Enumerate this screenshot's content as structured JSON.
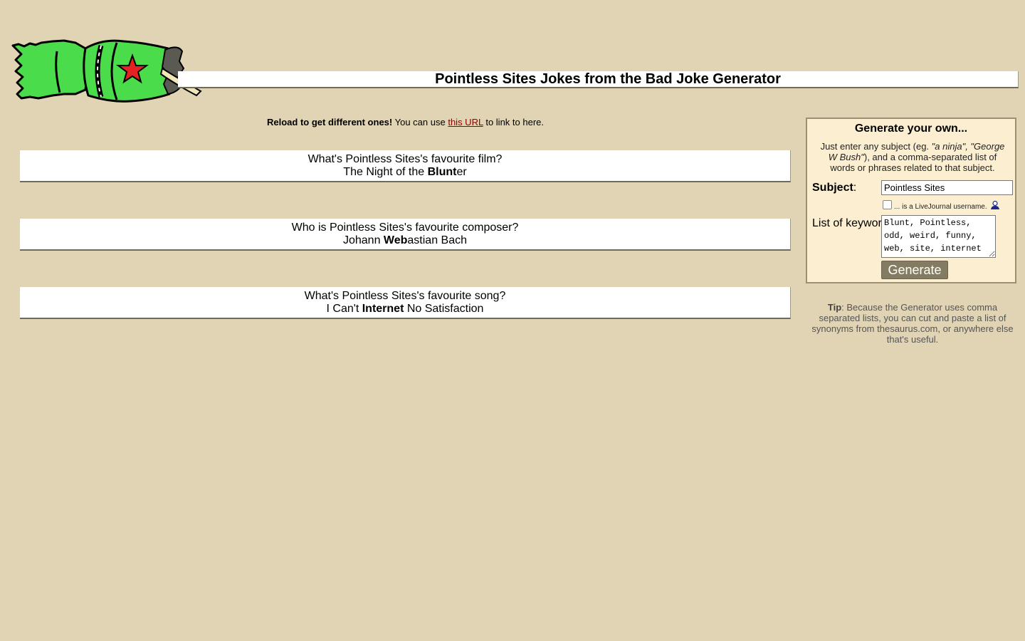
{
  "header": {
    "title": "Pointless Sites Jokes from the Bad Joke Generator",
    "logo_icon": "christmas-cracker-logo"
  },
  "intro": {
    "bold": "Reload to get different ones!",
    "text_before_link": "You can use",
    "link_text": "this URL",
    "text_after_link": "to link to here."
  },
  "jokes": [
    {
      "question": "What's Pointless Sites's favourite film?",
      "a_pre": "The Night of the ",
      "a_bold": "Blunt",
      "a_post": "er"
    },
    {
      "question": "Who is Pointless Sites's favourite composer?",
      "a_pre": "Johann ",
      "a_bold": "Web",
      "a_post": "astian Bach"
    },
    {
      "question": "What's Pointless Sites's favourite song?",
      "a_pre": "I Can't ",
      "a_bold": "Internet",
      "a_post": " No Satisfaction"
    }
  ],
  "generator": {
    "heading": "Generate your own...",
    "desc_pre": "Just enter any subject (eg. ",
    "desc_example": "\"a ninja\", \"George W Bush\"",
    "desc_post": "), and a comma-separated list of words or phrases related to that subject.",
    "subject_label": "Subject",
    "subject_value": "Pointless Sites",
    "lj_label": "... is a LiveJournal username.",
    "keywords_label": "List of keywords: (optional)",
    "keywords_value": "Blunt, Pointless, odd, weird, funny, web, site, internet",
    "button_label": "Generate"
  },
  "tip": {
    "bold": "Tip",
    "text": ": Because the Generator uses comma separated lists, you can cut and paste a list of synonyms from thesaurus.com, or anywhere else that's useful."
  },
  "colors": {
    "background": "#e0d4b4",
    "panel": "#fcefd1",
    "button": "#847c62",
    "link": "#8b0000"
  }
}
